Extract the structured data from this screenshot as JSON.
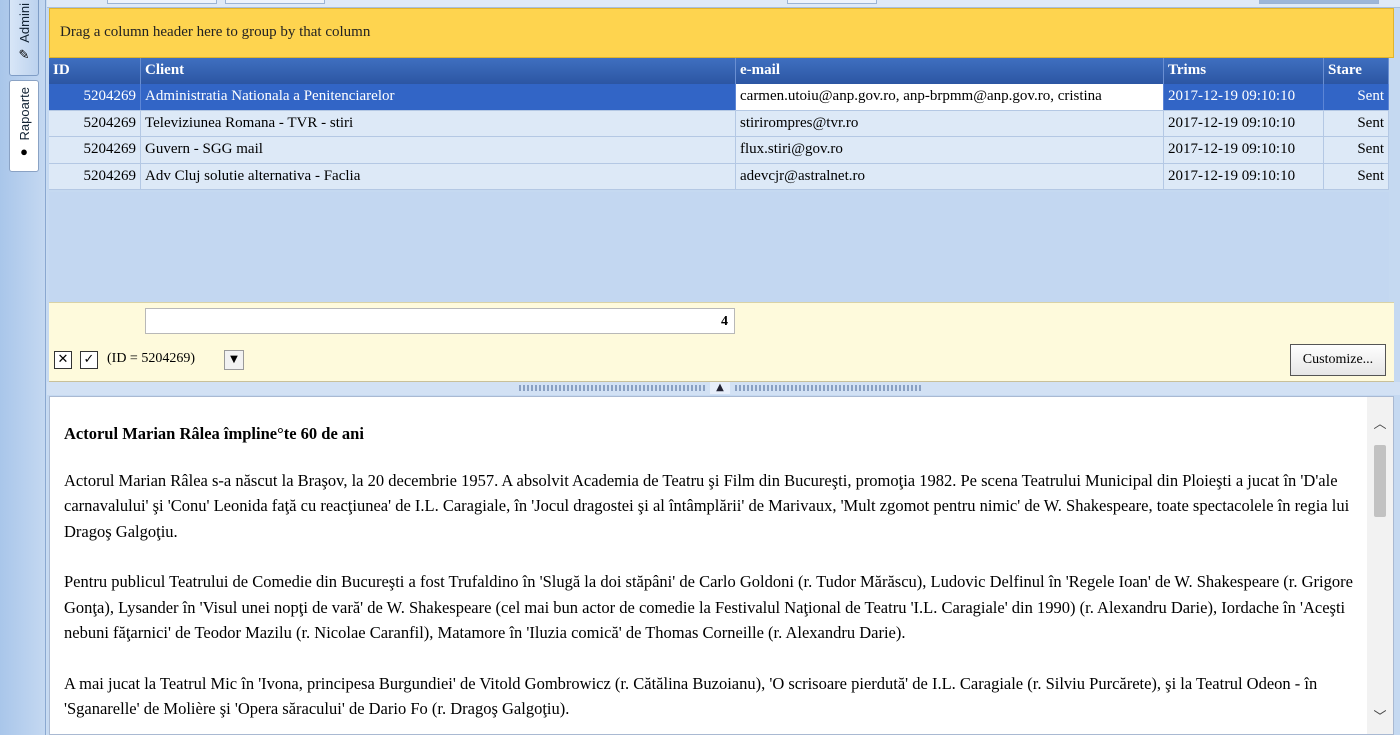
{
  "side_tabs": {
    "admin_label": "Admini",
    "rapoarte_label": "Rapoarte"
  },
  "group_panel": {
    "text": "Drag a column header here to group by that column"
  },
  "grid": {
    "columns": [
      "ID",
      "Client",
      "e-mail",
      "Trims",
      "Stare"
    ],
    "rows": [
      {
        "id": "5204269",
        "client": "Administratia Nationala a Penitenciarelor",
        "email": "carmen.utoiu@anp.gov.ro, anp-brpmm@anp.gov.ro, cristina",
        "trims": "2017-12-19 09:10:10",
        "stare": "Sent"
      },
      {
        "id": "5204269",
        "client": "Televiziunea Romana - TVR - stiri",
        "email": "stirirompres@tvr.ro",
        "trims": "2017-12-19 09:10:10",
        "stare": "Sent"
      },
      {
        "id": "5204269",
        "client": "Guvern - SGG mail",
        "email": "flux.stiri@gov.ro",
        "trims": "2017-12-19 09:10:10",
        "stare": "Sent"
      },
      {
        "id": "5204269",
        "client": "Adv Cluj solutie alternativa - Faclia",
        "email": "adevcjr@astralnet.ro",
        "trims": "2017-12-19 09:10:10",
        "stare": "Sent"
      }
    ],
    "selected_row": 0,
    "footer_count": "4"
  },
  "filter_bar": {
    "expression": "(ID = 5204269)",
    "customize_label": "Customize..."
  },
  "article": {
    "title": "Actorul Marian Râlea împline°te 60 de ani",
    "paragraphs": [
      "Actorul Marian Râlea s-a născut la Braşov, la 20 decembrie 1957. A absolvit Academia de Teatru şi Film din Bucureşti, promoţia 1982. Pe scena Teatrului Municipal din Ploieşti a jucat în 'D'ale carnavalului' şi 'Conu' Leonida faţă cu reacţiunea' de I.L. Caragiale, în 'Jocul dragostei şi al întâmplării' de Marivaux, 'Mult zgomot pentru nimic' de W. Shakespeare, toate spectacolele în regia lui Dragoş Galgoţiu.",
      "Pentru publicul Teatrului de Comedie din Bucureşti a fost Trufaldino în 'Slugă la doi stăpâni' de Carlo Goldoni (r. Tudor Mărăscu), Ludovic Delfinul în 'Regele Ioan' de W. Shakespeare (r. Grigore Gonţa), Lysander în 'Visul unei nopţi de vară' de W. Shakespeare (cel mai bun actor de comedie la Festivalul Naţional de Teatru 'I.L. Caragiale' din 1990) (r. Alexandru Darie), Iordache în 'Aceşti nebuni făţarnici' de Teodor Mazilu (r. Nicolae Caranfil), Matamore în 'Iluzia comică' de Thomas Corneille (r. Alexandru Darie).",
      "A mai jucat la Teatrul Mic în 'Ivona, principesa Burgundiei' de Vitold Gombrowicz (r. Cătălina Buzoianu), 'O scrisoare pierdută' de I.L. Caragiale (r. Silviu Purcărete), şi la Teatrul Odeon - în 'Sganarelle' de Molière şi 'Opera săracului' de Dario Fo (r. Dragoş Galgoţiu)."
    ]
  },
  "icons": {
    "admin": "pencil-icon",
    "rapoarte": "globe-icon",
    "filter_close": "close-icon",
    "filter_enable": "checkbox-icon",
    "filter_dropdown": "chevron-down-icon",
    "splitter": "chevron-up-icon",
    "scroll_up": "chevron-up-icon",
    "scroll_down": "chevron-down-icon"
  },
  "colors": {
    "group_panel": "#fed44f",
    "header": "#2c56a3",
    "selected_row": "#3265c6",
    "row": "#dde9f7",
    "footer": "#fefadc"
  }
}
